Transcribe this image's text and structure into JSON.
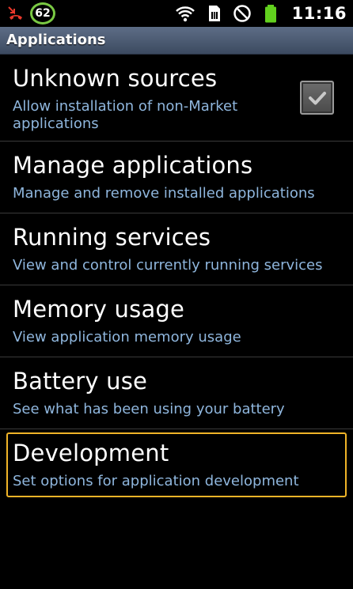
{
  "status_bar": {
    "signal_value": "62",
    "time": "11:16",
    "icons": [
      "missed-call-icon",
      "wifi-icon",
      "sim-icon",
      "no-entry-icon",
      "battery-icon"
    ],
    "colors": {
      "battery": "#62d11e",
      "badge_ring": "#7ac943",
      "missed_call": "#e8382b"
    }
  },
  "header": {
    "title": "Applications"
  },
  "settings": [
    {
      "title": "Unknown sources",
      "summary": "Allow installation of non-Market applications",
      "checkbox": true,
      "checked": true
    },
    {
      "title": "Manage applications",
      "summary": "Manage and remove installed applications"
    },
    {
      "title": "Running services",
      "summary": "View and control currently running services"
    },
    {
      "title": "Memory usage",
      "summary": "View application memory usage"
    },
    {
      "title": "Battery use",
      "summary": "See what has been using your battery"
    },
    {
      "title": "Development",
      "summary": "Set options for application development",
      "focused": true
    }
  ],
  "colors": {
    "summary_text": "#8fb6dd",
    "focus_border": "#f0b428"
  }
}
